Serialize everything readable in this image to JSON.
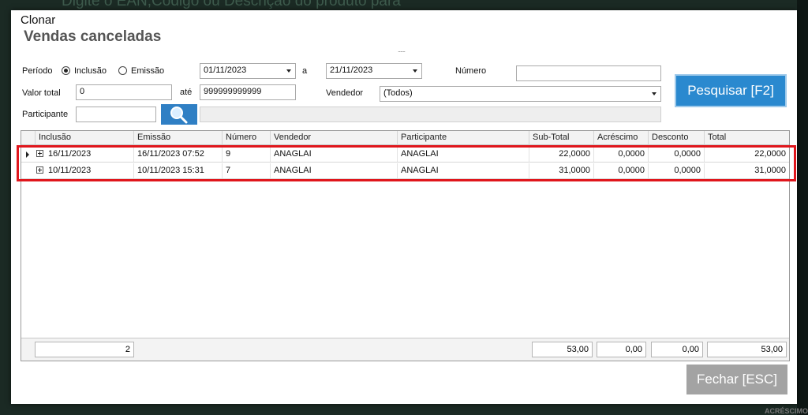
{
  "background": {
    "text": "Digite o EAN,Código ou Descrição do produto para",
    "right_text": "ACRÉSCIMO"
  },
  "dialog": {
    "clonar": "Clonar",
    "title": "Vendas canceladas",
    "grip": "......"
  },
  "filters": {
    "periodo_label": "Período",
    "radio_inclusao": "Inclusão",
    "radio_emissao": "Emissão",
    "selected_radio": "Inclusão",
    "date_from": "01/11/2023",
    "a_label": "a",
    "date_to": "21/11/2023",
    "numero_label": "Número",
    "numero_value": "",
    "valor_total_label": "Valor total",
    "valor_from": "0",
    "ate_label": "até",
    "valor_to": "999999999999",
    "vendedor_label": "Vendedor",
    "vendedor_value": "(Todos)",
    "participante_label": "Participante",
    "participante_value": "",
    "search_button": "Pesquisar [F2]"
  },
  "grid": {
    "columns": [
      "Inclusão",
      "Emissão",
      "Número",
      "Vendedor",
      "Participante",
      "Sub-Total",
      "Acréscimo",
      "Desconto",
      "Total"
    ],
    "rows": [
      [
        "16/11/2023",
        "16/11/2023 07:52",
        "9",
        "ANAGLAI",
        "ANAGLAI",
        "22,0000",
        "0,0000",
        "0,0000",
        "22,0000"
      ],
      [
        "10/11/2023",
        "10/11/2023 15:31",
        "7",
        "ANAGLAI",
        "ANAGLAI",
        "31,0000",
        "0,0000",
        "0,0000",
        "31,0000"
      ]
    ],
    "footer": {
      "count": "2",
      "subtotal": "53,00",
      "acrescimo": "0,00",
      "desconto": "0,00",
      "total": "53,00"
    }
  },
  "close_button": "Fechar [ESC]",
  "colors": {
    "search_button": "#2a89cf",
    "highlight": "#e0161c",
    "close_button": "#a3a3a3"
  }
}
